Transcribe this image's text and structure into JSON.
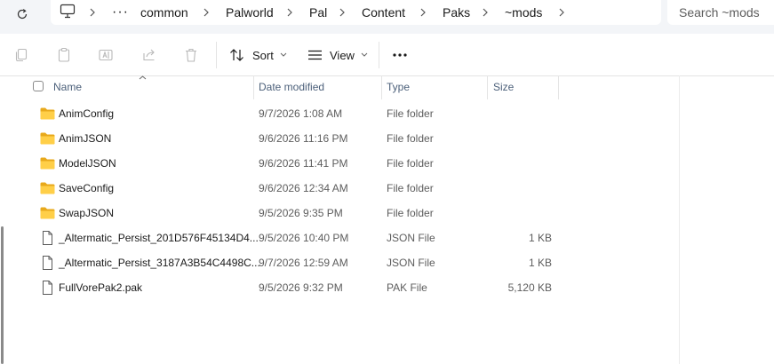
{
  "address": {
    "crumbs": [
      "common",
      "Palworld",
      "Pal",
      "Content",
      "Paks",
      "~mods"
    ],
    "search_placeholder": "Search ~mods"
  },
  "toolbar": {
    "sort_label": "Sort",
    "view_label": "View"
  },
  "columns": {
    "name": "Name",
    "date": "Date modified",
    "type": "Type",
    "size": "Size"
  },
  "files": [
    {
      "name": "AnimConfig",
      "date": "9/7/2026 1:08 AM",
      "type": "File folder",
      "size": "",
      "icon": "folder-icon"
    },
    {
      "name": "AnimJSON",
      "date": "9/6/2026 11:16 PM",
      "type": "File folder",
      "size": "",
      "icon": "folder-icon"
    },
    {
      "name": "ModelJSON",
      "date": "9/6/2026 11:41 PM",
      "type": "File folder",
      "size": "",
      "icon": "folder-icon"
    },
    {
      "name": "SaveConfig",
      "date": "9/6/2026 12:34 AM",
      "type": "File folder",
      "size": "",
      "icon": "folder-icon"
    },
    {
      "name": "SwapJSON",
      "date": "9/5/2026 9:35 PM",
      "type": "File folder",
      "size": "",
      "icon": "folder-icon"
    },
    {
      "name": "_Altermatic_Persist_201D576F45134D4...",
      "date": "9/5/2026 10:40 PM",
      "type": "JSON File",
      "size": "1 KB",
      "icon": "file-icon"
    },
    {
      "name": "_Altermatic_Persist_3187A3B54C4498C...",
      "date": "9/7/2026 12:59 AM",
      "type": "JSON File",
      "size": "1 KB",
      "icon": "file-icon"
    },
    {
      "name": "FullVorePak2.pak",
      "date": "9/5/2026 9:32 PM",
      "type": "PAK File",
      "size": "5,120 KB",
      "icon": "file-icon"
    }
  ]
}
